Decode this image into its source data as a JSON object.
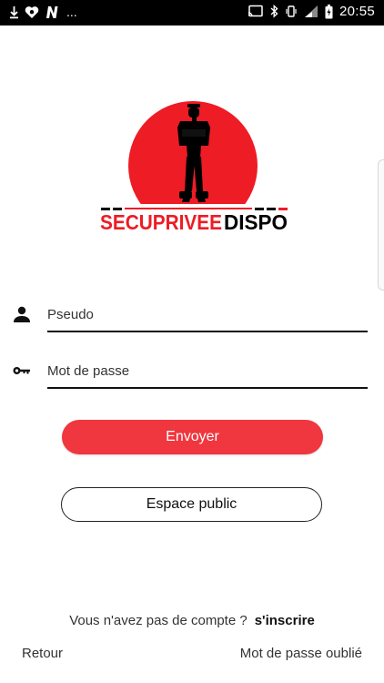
{
  "status_bar": {
    "overflow": "...",
    "time": "20:55",
    "icons": [
      "download-icon",
      "heart-icon",
      "n-icon",
      "cast-icon",
      "bluetooth-icon",
      "vibrate-icon",
      "signal-icon",
      "battery-charging-icon"
    ]
  },
  "logo": {
    "brand_part1": "SECUPRIVEE",
    "brand_part2": "DISPO",
    "circle_color": "#ee1c25",
    "text_color": "#000000"
  },
  "form": {
    "username_placeholder": "Pseudo",
    "password_placeholder": "Mot de passe",
    "send_label": "Envoyer",
    "public_label": "Espace public"
  },
  "footer": {
    "no_account_text": "Vous n'avez pas de compte ?",
    "signup_label": "s'inscrire",
    "back_label": "Retour",
    "forgot_label": "Mot de passe oublié"
  },
  "colors": {
    "accent": "#f0363e",
    "text": "#222222",
    "background": "#ffffff"
  }
}
